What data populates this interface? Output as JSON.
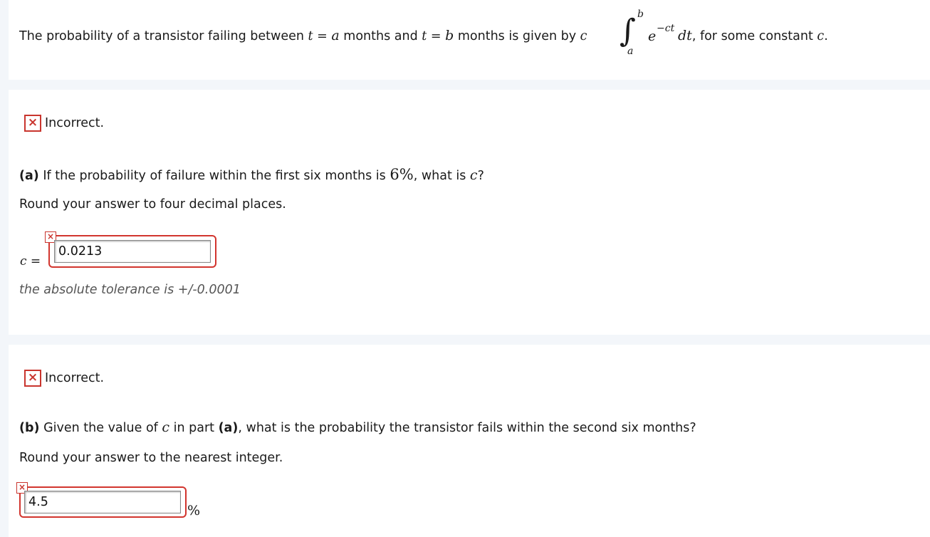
{
  "intro": {
    "text_1": "The probability of a transistor failing between ",
    "var_t": "t",
    "eq": "=",
    "var_a": "a",
    "text_2": " months and ",
    "var_b": "b",
    "text_3": " months is given by ",
    "var_c": "c",
    "int_upper": "b",
    "int_lower": "a",
    "integral_sign": "∫",
    "exp_base": "e",
    "exp_power": "−ct",
    "dt": "dt",
    "text_4": ", for some constant ",
    "text_end": "."
  },
  "part_a": {
    "status": "Incorrect.",
    "label": "(a)",
    "question_1": " If the probability of failure within the first six months is ",
    "value": "6%",
    "question_2": ", what is ",
    "question_end": "?",
    "instruction": "Round your answer to four decimal places.",
    "answer_label": "c =",
    "answer_value": "0.0213",
    "tolerance": "the absolute tolerance is +/-0.0001"
  },
  "part_b": {
    "status": "Incorrect.",
    "label": "(b)",
    "question_1": " Given the value of ",
    "question_2": " in part ",
    "ref": "(a)",
    "question_3": ", what is the probability the transistor fails within the second six months?",
    "instruction": "Round your answer to the nearest integer.",
    "answer_value": "4.5",
    "unit": "%"
  },
  "icons": {
    "incorrect_mark": "×"
  },
  "colors": {
    "error_red": "#c9352e",
    "background": "#f3f6fa"
  }
}
